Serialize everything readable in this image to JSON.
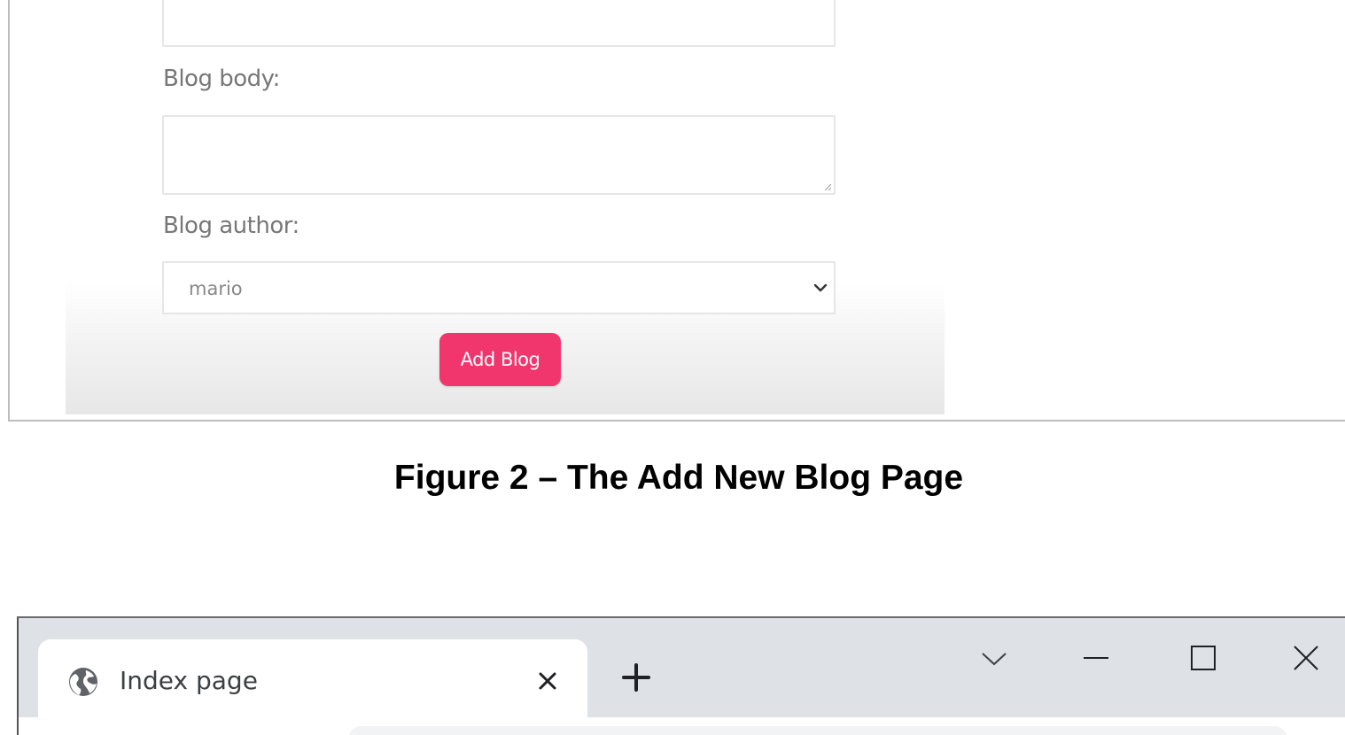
{
  "form": {
    "body_label": "Blog body:",
    "author_label": "Blog author:",
    "author_selected": "mario",
    "submit_label": "Add Blog",
    "accent_color": "#f1356d"
  },
  "caption": "Figure 2 – The Add New Blog Page",
  "browser": {
    "tab_title": "Index page",
    "tab_icon": "globe-icon",
    "icons": [
      "close-icon",
      "plus-icon",
      "chevron-down-icon",
      "minimize-icon",
      "maximize-icon",
      "close-icon"
    ]
  }
}
